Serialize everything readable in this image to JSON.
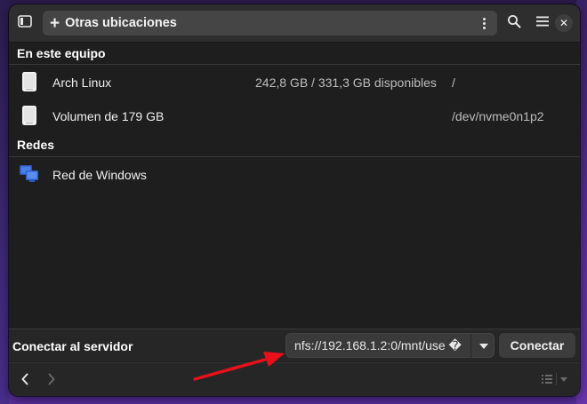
{
  "header": {
    "location_label": "Otras ubicaciones"
  },
  "sections": {
    "this_computer": "En este equipo",
    "networks": "Redes"
  },
  "drives": [
    {
      "name": "Arch Linux",
      "available": "242,8 GB / 331,3 GB disponibles",
      "mount": "/"
    },
    {
      "name": "Volumen de 179 GB",
      "available": "",
      "mount": "/dev/nvme0n1p2"
    }
  ],
  "networks": [
    {
      "name": "Red de Windows"
    }
  ],
  "connect": {
    "title": "Conectar al servidor",
    "server_value": "nfs://192.168.1.2:0/mnt/use �",
    "button_label": "Conectar"
  },
  "colors": {
    "annotation_arrow": "#e8111a",
    "network_icon": "#3b6fd8"
  },
  "icons": {
    "sidebar_toggle": "sidebar-icon",
    "add": "plus-icon",
    "menu": "kebab-menu-icon",
    "search": "search-icon",
    "main_menu": "hamburger-icon",
    "close": "close-icon",
    "drive": "drive-icon",
    "network": "network-icon",
    "dropdown": "chevron-down-icon",
    "back": "back-arrow-icon",
    "forward": "forward-arrow-icon",
    "view": "list-view-icon"
  }
}
